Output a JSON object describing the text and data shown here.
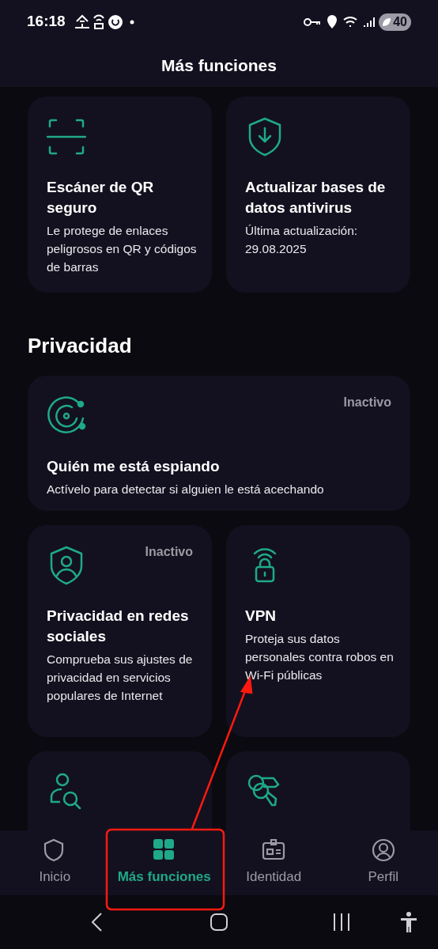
{
  "status_bar": {
    "time": "16:18",
    "battery": "40"
  },
  "header": {
    "title": "Más funciones"
  },
  "sections": [
    {
      "cards": [
        {
          "kind": "half",
          "title": "Escáner de QR seguro",
          "description": "Le protege de enlaces peligrosos en QR y códigos de barras"
        },
        {
          "kind": "half",
          "title": "Actualizar bases de datos antivirus",
          "description": "Última actualización: 29.08.2025"
        }
      ]
    },
    {
      "heading": "Privacidad",
      "cards": [
        {
          "kind": "wide",
          "title": "Quién me está espiando",
          "description": "Actívelo para detectar si alguien le está acechando",
          "status": "Inactivo"
        },
        {
          "kind": "half",
          "title": "Privacidad en redes sociales",
          "description": "Comprueba sus ajustes de privacidad en servicios populares de Internet",
          "status": "Inactivo"
        },
        {
          "kind": "half",
          "title": "VPN",
          "description": "Proteja sus datos personales contra robos en Wi-Fi públicas"
        },
        {
          "kind": "cut"
        },
        {
          "kind": "cut"
        }
      ]
    }
  ],
  "bottom_nav": [
    {
      "label": "Inicio",
      "selected": false
    },
    {
      "label": "Más funciones",
      "selected": true
    },
    {
      "label": "Identidad",
      "selected": false
    },
    {
      "label": "Perfil",
      "selected": false
    }
  ]
}
